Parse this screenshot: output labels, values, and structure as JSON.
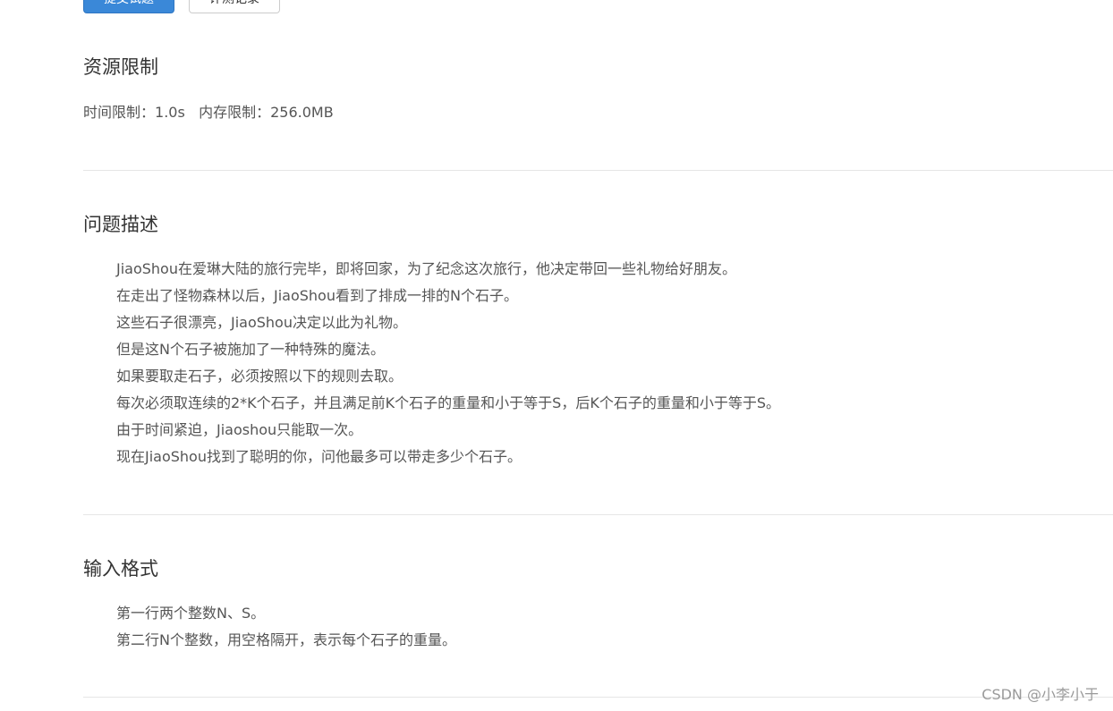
{
  "top_actions": {
    "submit_label": "提交试题",
    "record_label": "评测记录"
  },
  "resource_limit": {
    "title": "资源限制",
    "time_label": "时间限制：",
    "time_value": "1.0s",
    "memory_label": "内存限制：",
    "memory_value": "256.0MB"
  },
  "problem": {
    "title": "问题描述",
    "lines": [
      "JiaoShou在爱琳大陆的旅行完毕，即将回家，为了纪念这次旅行，他决定带回一些礼物给好朋友。",
      "在走出了怪物森林以后，JiaoShou看到了排成一排的N个石子。",
      "这些石子很漂亮，JiaoShou决定以此为礼物。",
      "但是这N个石子被施加了一种特殊的魔法。",
      "如果要取走石子，必须按照以下的规则去取。",
      "每次必须取连续的2*K个石子，并且满足前K个石子的重量和小于等于S，后K个石子的重量和小于等于S。",
      "由于时间紧迫，Jiaoshou只能取一次。",
      "现在JiaoShou找到了聪明的你，问他最多可以带走多少个石子。"
    ]
  },
  "input_format": {
    "title": "输入格式",
    "lines": [
      "第一行两个整数N、S。",
      "第二行N个整数，用空格隔开，表示每个石子的重量。"
    ]
  },
  "watermark": "CSDN @小李小于"
}
